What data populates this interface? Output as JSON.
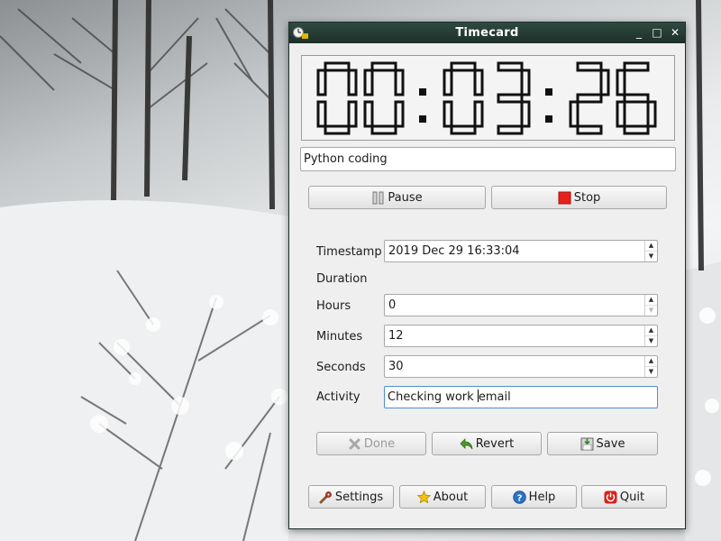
{
  "window": {
    "title": "Timecard"
  },
  "titlebar_buttons": {
    "minimize": "_",
    "maximize": "□",
    "close": "✕"
  },
  "clock": {
    "display": "00:03:26",
    "hours": "00",
    "minutes": "03",
    "seconds": "26"
  },
  "task_name": "Python coding",
  "timer_buttons": {
    "pause": "Pause",
    "stop": "Stop"
  },
  "form": {
    "timestamp_label": "Timestamp",
    "timestamp_value": "2019 Dec 29 16:33:04",
    "duration_label": "Duration",
    "hours_label": "Hours",
    "hours_value": "0",
    "minutes_label": "Minutes",
    "minutes_value": "12",
    "seconds_label": "Seconds",
    "seconds_value": "30",
    "activity_label": "Activity",
    "activity_value_before": "Checking work ",
    "activity_value_after": "email"
  },
  "edit_buttons": {
    "done": "Done",
    "revert": "Revert",
    "save": "Save"
  },
  "bottom_buttons": {
    "settings": "Settings",
    "about": "About",
    "help": "Help",
    "quit": "Quit"
  },
  "icons": {
    "app": "timecard-app-icon",
    "pause": "pause-icon",
    "stop": "stop-icon",
    "done": "x-icon",
    "revert": "revert-arrow-icon",
    "save": "save-disk-icon",
    "settings": "settings-wrench-icon",
    "about": "star-icon",
    "help": "help-question-icon",
    "quit": "power-icon"
  },
  "colors": {
    "titlebar": "#1d2f28",
    "stop_red": "#e8201c",
    "help_blue": "#2a74c8",
    "quit_red": "#d8201a",
    "about_star": "#f4c20d",
    "focus_border": "#4f8fd0"
  }
}
